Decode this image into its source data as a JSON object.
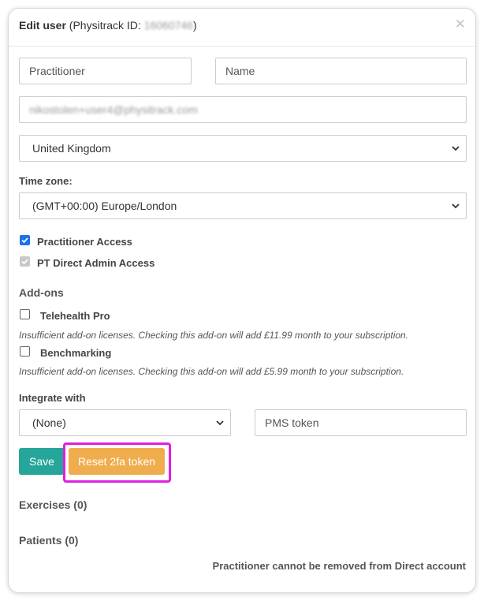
{
  "header": {
    "title": "Edit user",
    "subtitle_prefix": "(Physitrack ID: ",
    "user_id": "16060746",
    "subtitle_suffix": ")",
    "close_icon": "close-icon"
  },
  "form": {
    "first_name": {
      "placeholder": "Practitioner"
    },
    "last_name": {
      "placeholder": "Name"
    },
    "email": {
      "value": "nikostolen+user4@physitrack.com"
    },
    "country": {
      "selected": "United Kingdom"
    },
    "timezone": {
      "label": "Time zone:",
      "selected": "(GMT+00:00) Europe/London"
    },
    "access": [
      {
        "label": "Practitioner Access",
        "checked": true,
        "disabled": false
      },
      {
        "label": "PT Direct Admin Access",
        "checked": true,
        "disabled": true
      }
    ],
    "addons": {
      "heading": "Add-ons",
      "items": [
        {
          "label": "Telehealth Pro",
          "checked": false,
          "note": "Insufficient add-on licenses. Checking this add-on will add £11.99 month to your subscription."
        },
        {
          "label": "Benchmarking",
          "checked": false,
          "note": "Insufficient add-on licenses. Checking this add-on will add £5.99 month to your subscription."
        }
      ]
    },
    "integrate": {
      "label": "Integrate with",
      "selected": "(None)",
      "token_placeholder": "PMS token"
    }
  },
  "buttons": {
    "save": "Save",
    "reset_2fa": "Reset 2fa token"
  },
  "sections": {
    "exercises": "Exercises (0)",
    "patients": "Patients (0)"
  },
  "footer": {
    "note": "Practitioner cannot be removed from Direct account"
  },
  "colors": {
    "save_button": "#26a69a",
    "reset_button": "#f0ad4e",
    "highlight": "#e11ee1",
    "checkbox": "#1a73e8"
  }
}
